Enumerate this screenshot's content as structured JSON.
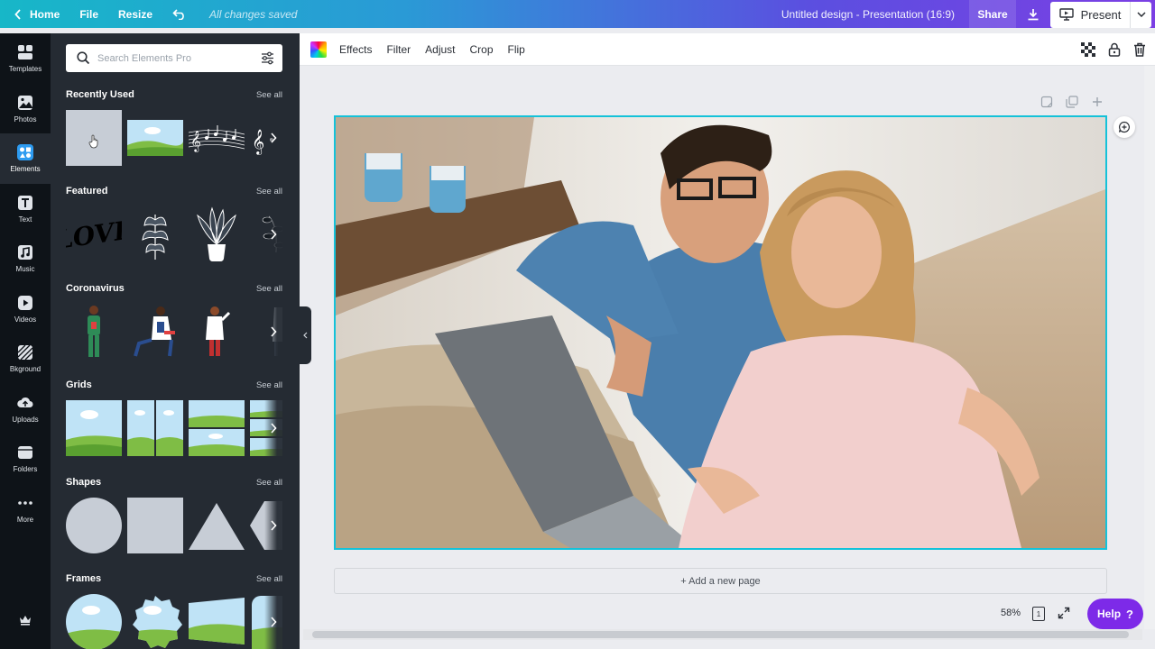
{
  "topbar": {
    "home_label": "Home",
    "file_label": "File",
    "resize_label": "Resize",
    "saved_status": "All changes saved",
    "design_title": "Untitled design - Presentation (16:9)",
    "share_label": "Share",
    "present_label": "Present"
  },
  "rail": {
    "items": [
      {
        "label": "Templates",
        "icon": "templates-icon"
      },
      {
        "label": "Photos",
        "icon": "photos-icon"
      },
      {
        "label": "Elements",
        "icon": "elements-icon",
        "active": true
      },
      {
        "label": "Text",
        "icon": "text-icon"
      },
      {
        "label": "Music",
        "icon": "music-icon"
      },
      {
        "label": "Videos",
        "icon": "videos-icon"
      },
      {
        "label": "Bkground",
        "icon": "background-icon"
      },
      {
        "label": "Uploads",
        "icon": "uploads-icon"
      },
      {
        "label": "Folders",
        "icon": "folders-icon"
      },
      {
        "label": "More",
        "icon": "more-icon"
      }
    ]
  },
  "panel": {
    "search_placeholder": "Search Elements Pro",
    "see_all_label": "See all",
    "sections": [
      {
        "title": "Recently Used"
      },
      {
        "title": "Featured"
      },
      {
        "title": "Coronavirus"
      },
      {
        "title": "Grids"
      },
      {
        "title": "Shapes"
      },
      {
        "title": "Frames"
      }
    ],
    "featured_love_text": "Love"
  },
  "toolbar": {
    "effects_label": "Effects",
    "filter_label": "Filter",
    "adjust_label": "Adjust",
    "crop_label": "Crop",
    "flip_label": "Flip"
  },
  "canvas": {
    "add_page_label": "+ Add a new page"
  },
  "footer": {
    "zoom_label": "58%",
    "page_count": "1",
    "help_label": "Help",
    "help_icon_text": "?"
  },
  "colors": {
    "accent": "#14c2d9",
    "help_button": "#7d2ae8",
    "panel_bg": "#252b33",
    "rail_bg": "#0e1318"
  }
}
